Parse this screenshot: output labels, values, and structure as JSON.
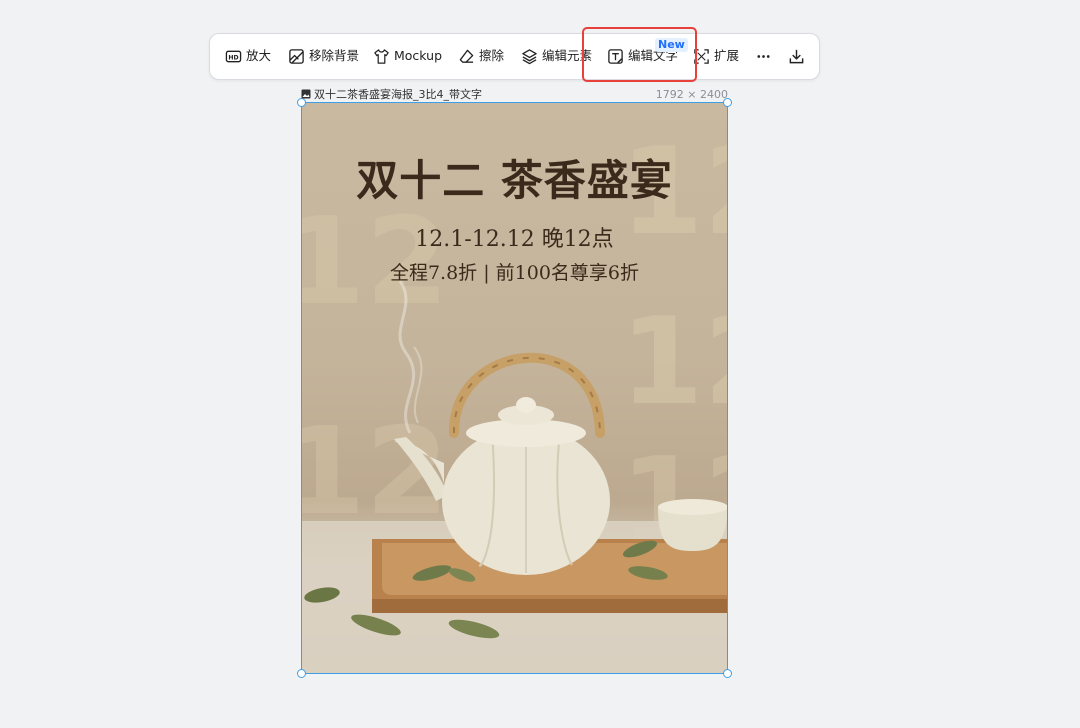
{
  "toolbar": {
    "items": [
      {
        "label": "放大",
        "icon": "hd-upscale-icon"
      },
      {
        "label": "移除背景",
        "icon": "remove-background-icon"
      },
      {
        "label": "Mockup",
        "icon": "tshirt-icon"
      },
      {
        "label": "擦除",
        "icon": "eraser-icon"
      },
      {
        "label": "编辑元素",
        "icon": "layers-icon"
      },
      {
        "label": "编辑文字",
        "icon": "text-edit-icon"
      },
      {
        "label": "扩展",
        "icon": "expand-icon"
      }
    ],
    "new_badge": "New",
    "more_icon": "more-icon",
    "download_icon": "download-icon",
    "highlight_color": "#e8403a"
  },
  "file": {
    "name": "双十二茶香盛宴海报_3比4_带文字",
    "dimensions": "1792 × 2400",
    "icon": "image-icon"
  },
  "poster": {
    "title": "双十二 茶香盛宴",
    "date_line": "12.1-12.12 晚12点",
    "offer_line": "全程7.8折 | 前100名尊享6折",
    "background_numeral": "12"
  },
  "colors": {
    "selection": "#3f9ee8",
    "poster_text": "#3b2a1c",
    "badge_text": "#1f6fff"
  }
}
